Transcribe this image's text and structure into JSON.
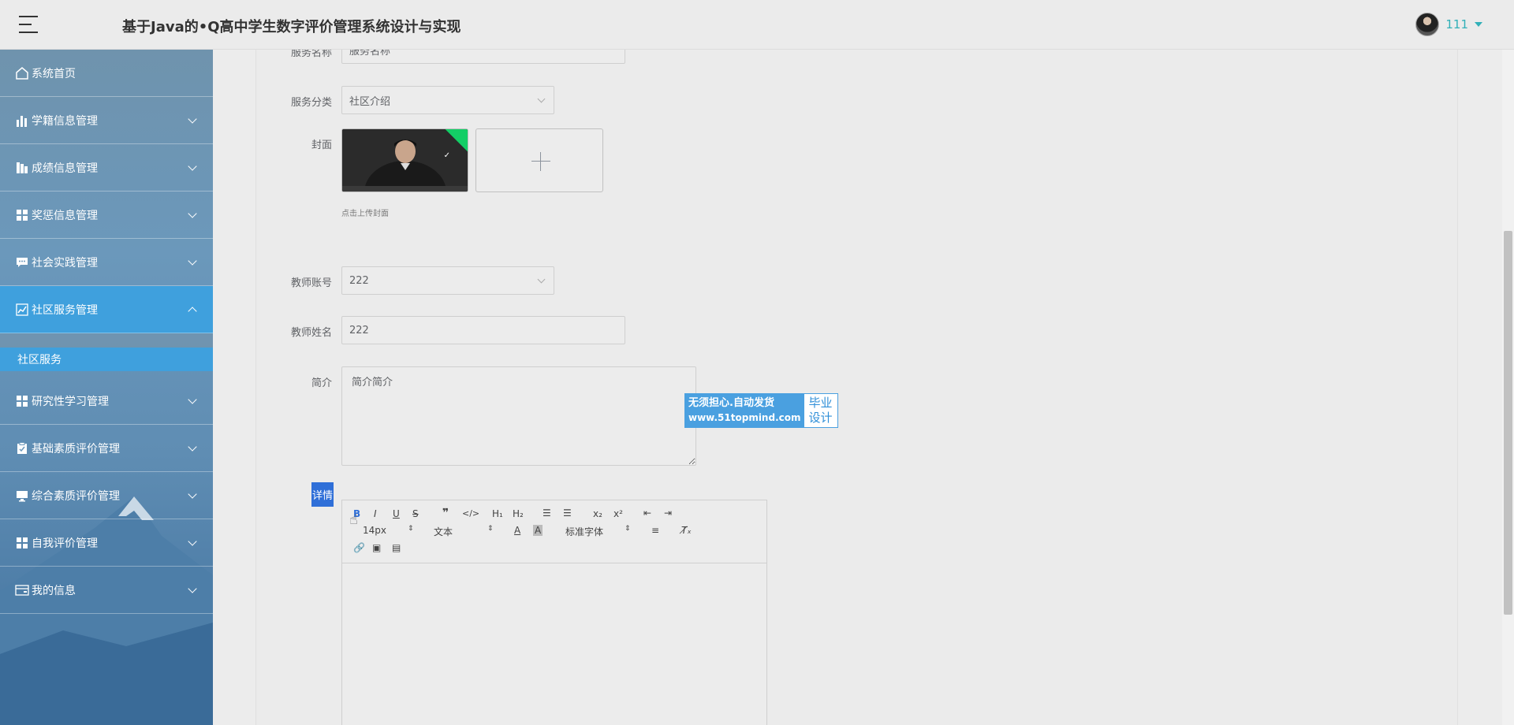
{
  "header": {
    "title": "基于Java的•Q高中学生数字评价管理系统设计与实现",
    "user": "111"
  },
  "sidebar": {
    "items": [
      {
        "label": "系统首页",
        "icon": "home-icon"
      },
      {
        "label": "学籍信息管理",
        "icon": "bar-chart-icon"
      },
      {
        "label": "成绩信息管理",
        "icon": "columns-icon"
      },
      {
        "label": "奖惩信息管理",
        "icon": "grid-icon"
      },
      {
        "label": "社会实践管理",
        "icon": "chat-icon"
      },
      {
        "label": "社区服务管理",
        "icon": "line-chart-icon"
      },
      {
        "label": "研究性学习管理",
        "icon": "grid-icon"
      },
      {
        "label": "基础素质评价管理",
        "icon": "clipboard-icon"
      },
      {
        "label": "综合素质评价管理",
        "icon": "monitor-icon"
      },
      {
        "label": "自我评价管理",
        "icon": "grid-icon"
      },
      {
        "label": "我的信息",
        "icon": "card-icon"
      }
    ],
    "sub_item": "社区服务"
  },
  "form": {
    "service_name_label": "服务名称",
    "service_name_placeholder": "服务名称",
    "category_label": "服务分类",
    "category_value": "社区介绍",
    "cover_label": "封面",
    "cover_hint": "点击上传封面",
    "teacher_account_label": "教师账号",
    "teacher_account_value": "222",
    "teacher_name_label": "教师姓名",
    "teacher_name_value": "222",
    "intro_label": "简介",
    "intro_value": "简介简介",
    "detail_label": "详情"
  },
  "editor": {
    "font_size": "14px",
    "text_type": "文本",
    "font_family": "标准字体"
  },
  "ad": {
    "line1": "无须担心.自动发货",
    "line2": "www.51topmind.com",
    "right1": "毕业",
    "right2": "设计"
  }
}
